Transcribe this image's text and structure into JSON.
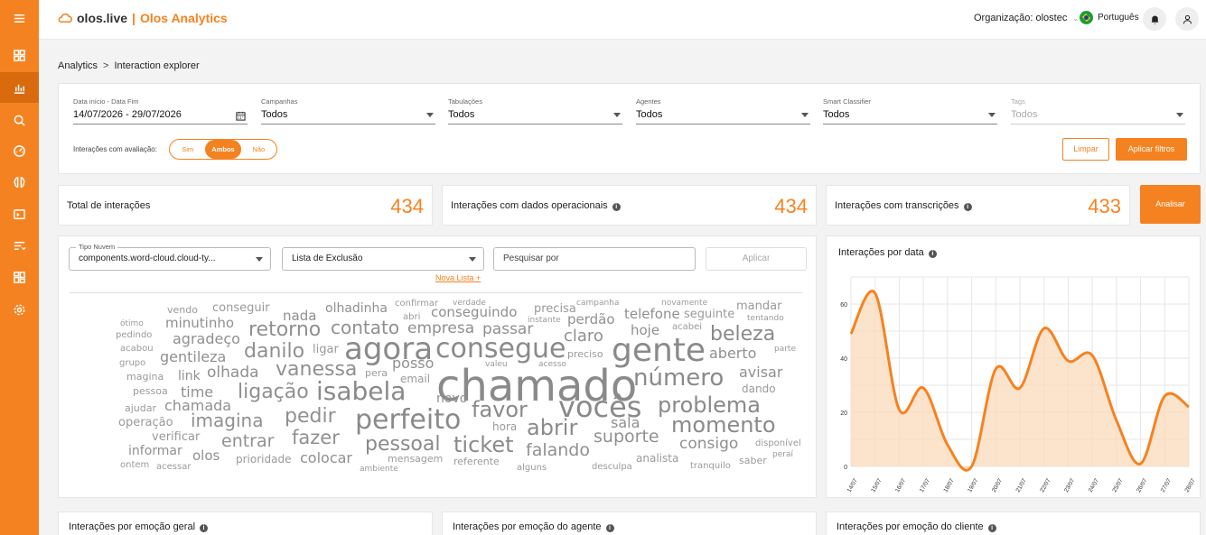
{
  "app": {
    "brand": "olos.live",
    "separator": "|",
    "product": "Olos Analytics",
    "org_label": "Organização: olostec",
    "language": "Português"
  },
  "sidebar": {
    "items": [
      {
        "icon": "menu-icon"
      },
      {
        "icon": "dashboard-grid-icon"
      },
      {
        "icon": "bar-chart-icon",
        "active": true
      },
      {
        "icon": "search-icon"
      },
      {
        "icon": "gauge-icon"
      },
      {
        "icon": "brain-icon"
      },
      {
        "icon": "terminal-icon"
      },
      {
        "icon": "list-filter-icon"
      },
      {
        "icon": "apps-icon"
      },
      {
        "icon": "settings-icon"
      }
    ]
  },
  "breadcrumb": {
    "root": "Analytics",
    "arrow": ">",
    "current": "Interaction explorer"
  },
  "filters": {
    "date": {
      "label": "Data início - Data Fim",
      "value": "14/07/2026 - 29/07/2026"
    },
    "campanhas": {
      "label": "Campanhas",
      "value": "Todos"
    },
    "tabulacoes": {
      "label": "Tabulações",
      "value": "Todos"
    },
    "agentes": {
      "label": "Agentes",
      "value": "Todos"
    },
    "smart": {
      "label": "Smart Classifier",
      "value": "Todos"
    },
    "tags": {
      "label": "Tags",
      "value": "Todos"
    },
    "evaluation_label": "Interações com avaliação:",
    "evaluation_options": [
      "Sim",
      "Ambos",
      "Não"
    ],
    "evaluation_selected": "Ambos",
    "clear_label": "Limpar",
    "apply_label": "Aplicar filtros"
  },
  "stats": {
    "total": {
      "label": "Total de interações",
      "value": "434"
    },
    "operational": {
      "label": "Interações com dados operacionais",
      "value": "434"
    },
    "transcriptions": {
      "label": "Interações com transcrições",
      "value": "433"
    },
    "analyze_label": "Analisar"
  },
  "wordcloud": {
    "type_label": "Tipo Nuvem",
    "type_value": "components.word-cloud.cloud-ty...",
    "exclusion_value": "Lista de Exclusão",
    "search_placeholder": "Pesquisar por",
    "apply_label": "Aplicar",
    "new_list_label": "Nova Lista +",
    "words": [
      [
        "chamado",
        48
      ],
      [
        "agora",
        34
      ],
      [
        "consegue",
        30
      ],
      [
        "gente",
        36
      ],
      [
        "vocês",
        32
      ],
      [
        "perfeito",
        30
      ],
      [
        "isabela",
        28
      ],
      [
        "favor",
        24
      ],
      [
        "abrir",
        24
      ],
      [
        "problema",
        24
      ],
      [
        "momento",
        24
      ],
      [
        "beleza",
        22
      ],
      [
        "número",
        26
      ],
      [
        "vanessa",
        22
      ],
      [
        "danilo",
        22
      ],
      [
        "retorno",
        22
      ],
      [
        "contato",
        20
      ],
      [
        "ligação",
        22
      ],
      [
        "pedir",
        22
      ],
      [
        "imagina",
        20
      ],
      [
        "entrar",
        19
      ],
      [
        "fazer",
        21
      ],
      [
        "pessoal",
        22
      ],
      [
        "ticket",
        24
      ],
      [
        "falando",
        19
      ],
      [
        "suporte",
        19
      ],
      [
        "consigo",
        17
      ],
      [
        "claro",
        18
      ],
      [
        "empresa",
        17
      ],
      [
        "passar",
        17
      ],
      [
        "posso",
        16
      ],
      [
        "olhada",
        17
      ],
      [
        "gentileza",
        16
      ],
      [
        "agradeço",
        16
      ],
      [
        "minutinho",
        15
      ],
      [
        "conseguindo",
        15
      ],
      [
        "perdão",
        15
      ],
      [
        "telefone",
        15
      ],
      [
        "hoje",
        15
      ],
      [
        "aberto",
        16
      ],
      [
        "avisar",
        16
      ],
      [
        "chamada",
        16
      ],
      [
        "time",
        16
      ],
      [
        "sala",
        16
      ],
      [
        "olos",
        15
      ],
      [
        "colocar",
        16
      ],
      [
        "olhadinha",
        14
      ],
      [
        "nada",
        15
      ],
      [
        "conseguir",
        13
      ],
      [
        "precisa",
        13
      ],
      [
        "seguinte",
        13
      ],
      [
        "mandar",
        13
      ],
      [
        "dando",
        12
      ],
      [
        "email",
        12
      ],
      [
        "novo",
        14
      ],
      [
        "hora",
        12
      ],
      [
        "analista",
        12
      ],
      [
        "mensagem",
        11
      ],
      [
        "referente",
        11
      ],
      [
        "prioridade",
        12
      ],
      [
        "verificar",
        13
      ],
      [
        "informar",
        14
      ],
      [
        "operação",
        13
      ],
      [
        "ajudar",
        11
      ],
      [
        "pessoa",
        11
      ],
      [
        "link",
        14
      ],
      [
        "magina",
        11
      ],
      [
        "grupo",
        10
      ],
      [
        "acabou",
        10
      ],
      [
        "pedindo",
        10
      ],
      [
        "ótimo",
        9
      ],
      [
        "vendo",
        11
      ],
      [
        "ligar",
        13
      ],
      [
        "pera",
        11
      ],
      [
        "preciso",
        11
      ],
      [
        "confirmar",
        10
      ],
      [
        "abri",
        10
      ],
      [
        "verdade",
        9
      ],
      [
        "campanha",
        9
      ],
      [
        "instante",
        9
      ],
      [
        "acabei",
        10
      ],
      [
        "novamente",
        9
      ],
      [
        "tentando",
        9
      ],
      [
        "parte",
        9
      ],
      [
        "valeu",
        9
      ],
      [
        "acesso",
        9
      ],
      [
        "acessar",
        10
      ],
      [
        "ontem",
        10
      ],
      [
        "ambiente",
        9
      ],
      [
        "alguns",
        10
      ],
      [
        "desculpa",
        10
      ],
      [
        "tranquilo",
        10
      ],
      [
        "saber",
        11
      ],
      [
        "disponível",
        10
      ],
      [
        "peraí",
        9
      ]
    ]
  },
  "chart_data": {
    "type": "area",
    "title": "Interações por data",
    "x": [
      "14/07",
      "15/07",
      "16/07",
      "17/07",
      "18/07",
      "19/07",
      "20/07",
      "21/07",
      "22/07",
      "23/07",
      "24/07",
      "25/07",
      "26/07",
      "27/07",
      "28/07"
    ],
    "values": [
      49,
      64,
      21,
      29,
      8,
      0,
      36,
      29,
      51,
      39,
      41,
      17,
      1,
      26,
      22
    ],
    "ylim": [
      0,
      70
    ],
    "yticks": [
      0,
      20,
      40,
      60
    ],
    "grid": true,
    "color": "#f58220",
    "fill_color": "#fbd9b9"
  },
  "bottom_panels": [
    {
      "label": "Interações por emoção geral"
    },
    {
      "label": "Interações por emoção do agente"
    },
    {
      "label": "Interações por emoção do cliente"
    }
  ],
  "colors": {
    "accent": "#f58220",
    "accent_dark": "#d96a0e"
  }
}
